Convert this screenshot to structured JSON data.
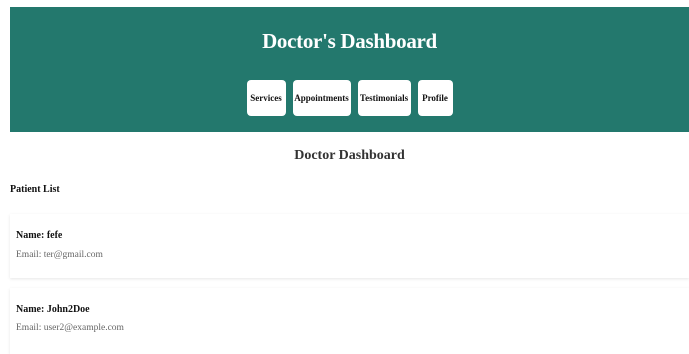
{
  "header": {
    "title": "Doctor's Dashboard",
    "nav": [
      {
        "label": "Services"
      },
      {
        "label": "Appointments"
      },
      {
        "label": "Testimonials"
      },
      {
        "label": "Profile"
      }
    ]
  },
  "main": {
    "title": "Doctor Dashboard",
    "patient_list_title": "Patient List",
    "patients": [
      {
        "name": "Name: fefe",
        "email": "Email: ter@gmail.com"
      },
      {
        "name": "Name: John2Doe",
        "email": "Email: user2@example.com"
      }
    ]
  },
  "colors": {
    "header_bg": "#23786d",
    "nav_button_bg": "#ffffff"
  }
}
